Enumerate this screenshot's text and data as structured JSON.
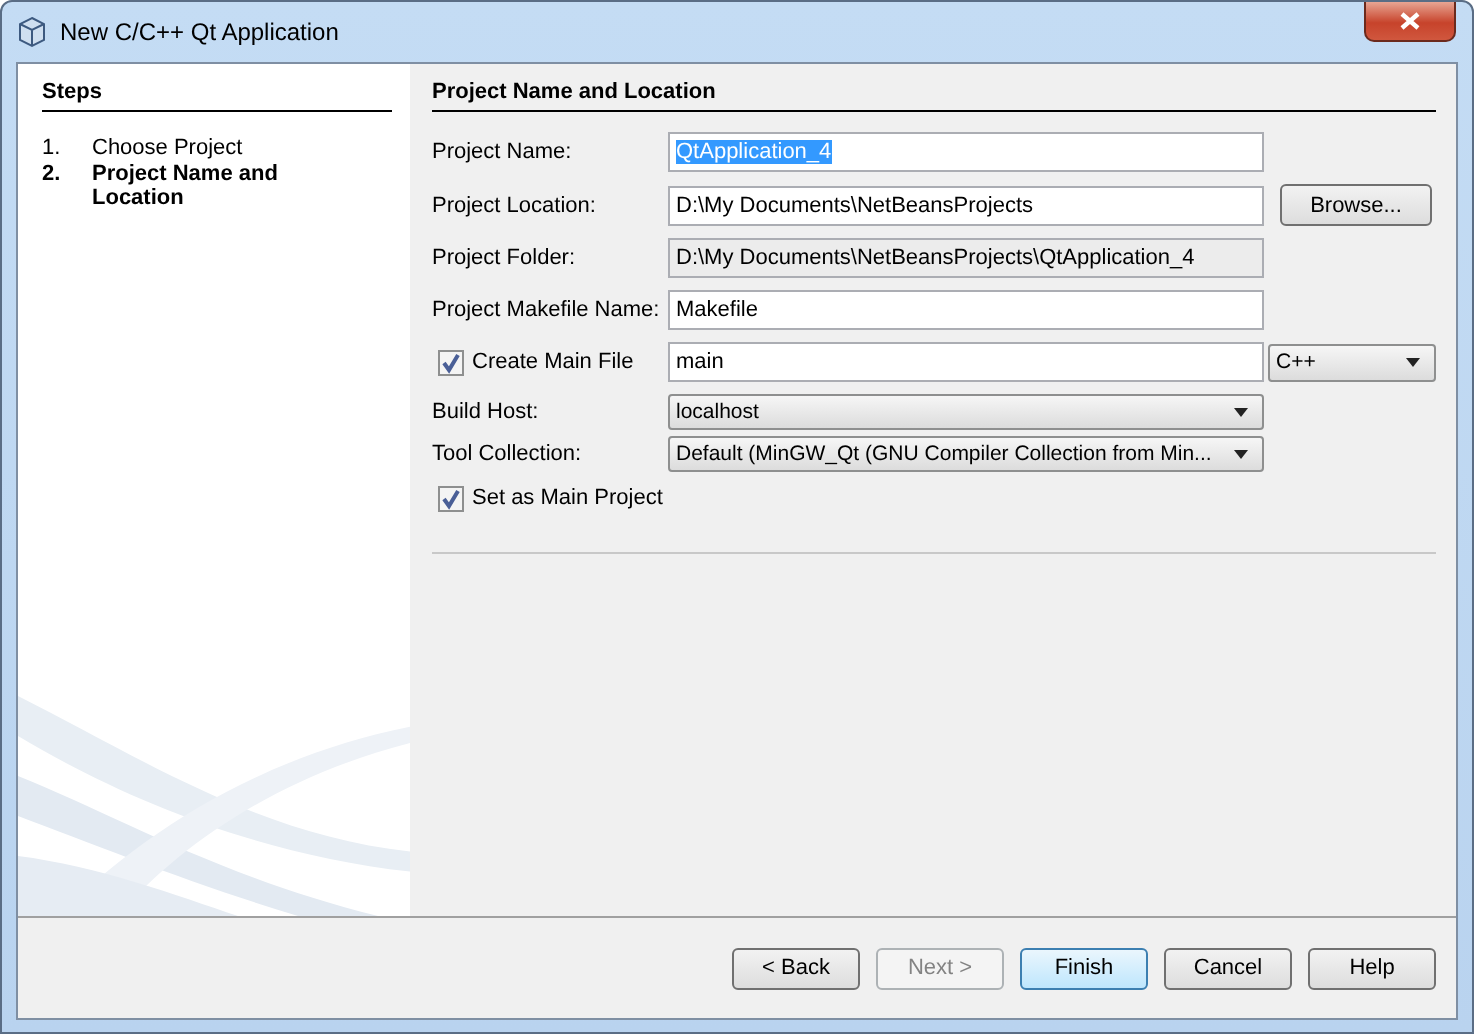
{
  "window": {
    "title": "New C/C++ Qt Application"
  },
  "steps": {
    "title": "Steps",
    "items": [
      {
        "number": "1.",
        "label": "Choose Project",
        "selected": false
      },
      {
        "number": "2.",
        "label": "Project Name and Location",
        "selected": true
      }
    ]
  },
  "panel": {
    "title": "Project Name and Location",
    "rows": [
      {
        "kind": "text",
        "label": "Project Name:",
        "value": "QtApplication_4",
        "text_selected": true,
        "disabled": false
      },
      {
        "kind": "text",
        "label": "Project Location:",
        "value": "D:\\My Documents\\NetBeansProjects",
        "text_selected": false,
        "disabled": false,
        "button": "Browse..."
      },
      {
        "kind": "text",
        "label": "Project Folder:",
        "value": "D:\\My Documents\\NetBeansProjects\\QtApplication_4",
        "text_selected": false,
        "disabled": true
      },
      {
        "kind": "text",
        "label": "Project Makefile Name:",
        "value": "Makefile",
        "text_selected": false,
        "disabled": false
      },
      {
        "kind": "check-text",
        "label": "Create Main File",
        "checked": true,
        "value": "main",
        "combo": "C++"
      },
      {
        "kind": "combo",
        "label": "Build Host:",
        "value": "localhost"
      },
      {
        "kind": "combo",
        "label": "Tool Collection:",
        "value": "Default (MinGW_Qt (GNU Compiler Collection from Min..."
      },
      {
        "kind": "check",
        "label": "Set as Main Project",
        "checked": true
      }
    ]
  },
  "buttons": [
    {
      "label": "< Back",
      "disabled": false,
      "default": false
    },
    {
      "label": "Next >",
      "disabled": true,
      "default": false
    },
    {
      "label": "Finish",
      "disabled": false,
      "default": true
    },
    {
      "label": "Cancel",
      "disabled": false,
      "default": false
    },
    {
      "label": "Help",
      "disabled": false,
      "default": false
    }
  ]
}
